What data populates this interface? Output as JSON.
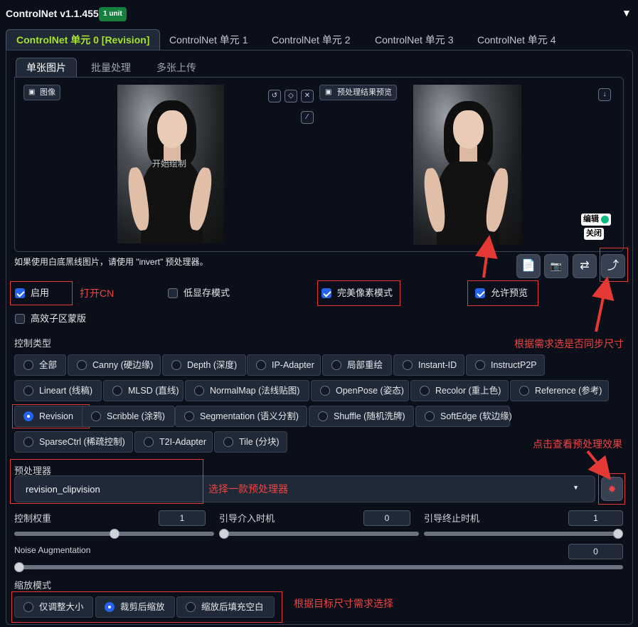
{
  "header": {
    "title": "ControlNet v1.1.455",
    "badge": "1 unit",
    "collapse": "▼"
  },
  "unit_tabs": [
    "ControlNet 单元 0 [Revision]",
    "ControlNet 单元 1",
    "ControlNet 单元 2",
    "ControlNet 单元 3",
    "ControlNet 单元 4"
  ],
  "image_tabs": [
    "单张图片",
    "批量处理",
    "多张上传"
  ],
  "input_image": {
    "label": "图像",
    "overlay": "开始绘制"
  },
  "preview": {
    "label": "预处理结果预览",
    "edit": "编辑",
    "close": "关闭"
  },
  "hint": "如果使用白底黑线图片，请使用 \"invert\" 预处理器。",
  "checkboxes": {
    "enable": "启用",
    "low_vram": "低显存模式",
    "pixel_perfect": "完美像素模式",
    "allow_preview": "允许预览",
    "effective_mask": "高效子区蒙版"
  },
  "control_type": {
    "label": "控制类型",
    "selected": "Revision",
    "rows": [
      [
        "全部",
        "Canny (硬边缘)",
        "Depth (深度)",
        "IP-Adapter",
        "局部重绘",
        "Instant-ID",
        "InstructP2P"
      ],
      [
        "Lineart (线稿)",
        "MLSD (直线)",
        "NormalMap (法线贴图)",
        "OpenPose (姿态)",
        "Recolor (重上色)",
        "Reference (参考)"
      ],
      [
        "Revision",
        "Scribble (涂鸦)",
        "Segmentation (语义分割)",
        "Shuffle (随机洗牌)",
        "SoftEdge (软边缘)"
      ],
      [
        "SparseCtrl (稀疏控制)",
        "T2I-Adapter",
        "Tile (分块)"
      ]
    ]
  },
  "preprocessor": {
    "label": "预处理器",
    "value": "revision_clipvision"
  },
  "weights": {
    "control_weight": {
      "label": "控制权重",
      "value": "1",
      "fraction": 0.5
    },
    "start": {
      "label": "引导介入时机",
      "value": "0",
      "fraction": 0
    },
    "end": {
      "label": "引导终止时机",
      "value": "1",
      "fraction": 1
    }
  },
  "noise": {
    "label": "Noise Augmentation",
    "value": "0",
    "fraction": 0
  },
  "resize": {
    "label": "缩放模式",
    "options": [
      "仅调整大小",
      "裁剪后缩放",
      "缩放后填充空白"
    ],
    "selected": "裁剪后缩放"
  },
  "annotations": {
    "enable_cn": "打开CN",
    "sync_size": "根据需求选是否同步尺寸",
    "view_preprocess": "点击查看预处理效果",
    "choose_preprocessor": "选择一款预处理器",
    "choose_resize": "根据目标尺寸需求选择"
  },
  "colors": {
    "accent_green": "#a6e22e",
    "annotation_red": "#e53935",
    "checkbox_blue": "#2563eb",
    "badge_green": "#15803d"
  }
}
